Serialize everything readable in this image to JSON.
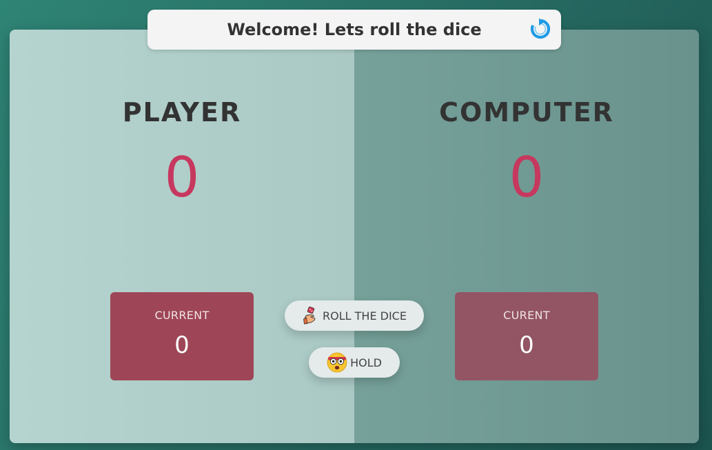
{
  "header": {
    "message": "Welcome! Lets roll the dice",
    "reset_icon": "refresh-icon"
  },
  "player": {
    "name": "PLAYER",
    "score": "0",
    "current_label": "CURRENT",
    "current_value": "0"
  },
  "computer": {
    "name": "COMPUTER",
    "score": "0",
    "current_label": "CURENT",
    "current_value": "0"
  },
  "actions": {
    "roll_label": "ROLL THE DICE",
    "roll_icon": "dice-hand-icon",
    "hold_label": "HOLD",
    "hold_icon": "shocked-face-icon"
  },
  "colors": {
    "score": "#c7385e",
    "player_current_bg": "#9e4657",
    "computer_current_bg": "#935563",
    "reset_icon": "#1e9be6"
  }
}
